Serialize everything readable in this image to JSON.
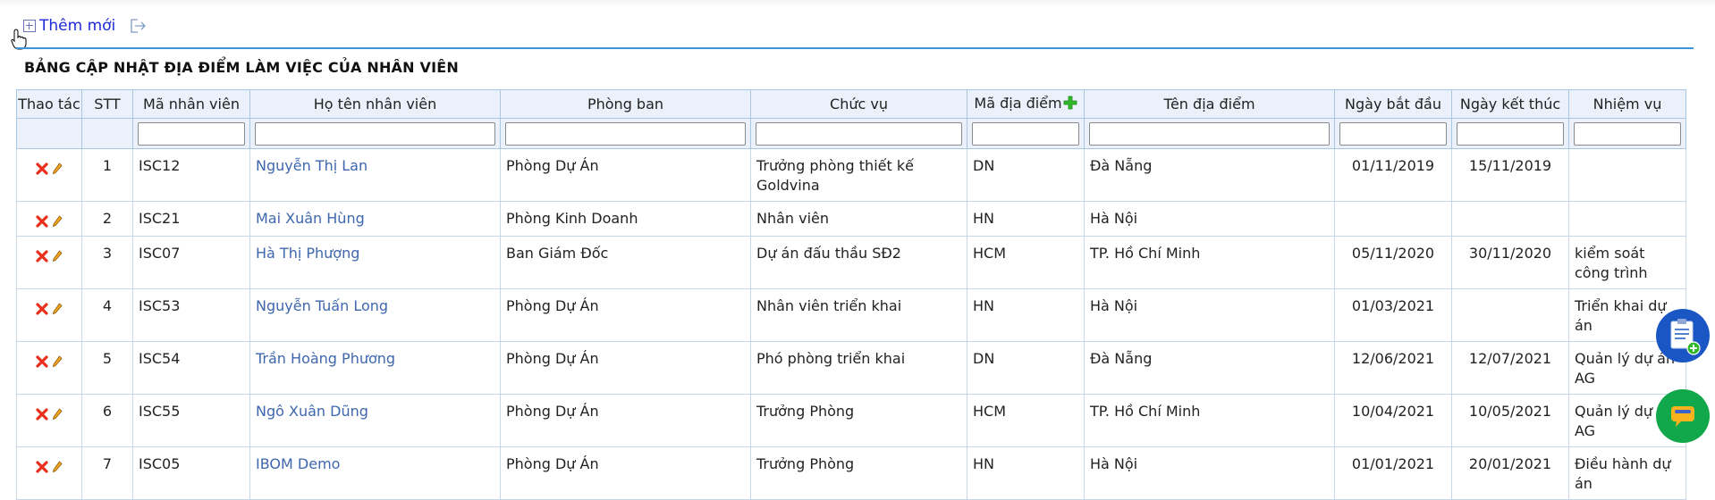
{
  "toolbar": {
    "add_label": "Thêm mới"
  },
  "page_title": "BẢNG CẬP NHẬT ĐỊA ĐIỂM LÀM VIỆC CỦA NHÂN VIÊN",
  "columns": [
    "Thao tác",
    "STT",
    "Mã nhân viên",
    "Họ tên nhân viên",
    "Phòng ban",
    "Chức vụ",
    "Mã địa điểm",
    "Tên địa điểm",
    "Ngày bắt đầu",
    "Ngày kết thúc",
    "Nhiệm vụ"
  ],
  "rows": [
    {
      "stt": "1",
      "ma_nv": "ISC12",
      "ho_ten": "Nguyễn Thị Lan",
      "phong_ban": "Phòng Dự Án",
      "chuc_vu": "Trưởng phòng thiết kế Goldvina",
      "ma_dd": "DN",
      "ten_dd": "Đà Nẵng",
      "bat_dau": "01/11/2019",
      "ket_thuc": "15/11/2019",
      "nhiem_vu": ""
    },
    {
      "stt": "2",
      "ma_nv": "ISC21",
      "ho_ten": "Mai Xuân Hùng",
      "phong_ban": "Phòng Kinh Doanh",
      "chuc_vu": "Nhân viên",
      "ma_dd": "HN",
      "ten_dd": "Hà Nội",
      "bat_dau": "",
      "ket_thuc": "",
      "nhiem_vu": ""
    },
    {
      "stt": "3",
      "ma_nv": "ISC07",
      "ho_ten": "Hà Thị Phượng",
      "phong_ban": "Ban Giám Đốc",
      "chuc_vu": "Dự án đấu thầu SĐ2",
      "ma_dd": "HCM",
      "ten_dd": "TP. Hồ Chí Minh",
      "bat_dau": "05/11/2020",
      "ket_thuc": "30/11/2020",
      "nhiem_vu": "kiểm soát công trình"
    },
    {
      "stt": "4",
      "ma_nv": "ISC53",
      "ho_ten": "Nguyễn Tuấn Long",
      "phong_ban": "Phòng Dự Án",
      "chuc_vu": "Nhân viên triển khai",
      "ma_dd": "HN",
      "ten_dd": "Hà Nội",
      "bat_dau": "01/03/2021",
      "ket_thuc": "",
      "nhiem_vu": "Triển khai dự án"
    },
    {
      "stt": "5",
      "ma_nv": "ISC54",
      "ho_ten": "Trần Hoàng Phương",
      "phong_ban": "Phòng Dự Án",
      "chuc_vu": "Phó phòng triển khai",
      "ma_dd": "DN",
      "ten_dd": "Đà Nẵng",
      "bat_dau": "12/06/2021",
      "ket_thuc": "12/07/2021",
      "nhiem_vu": "Quản lý dự án AG"
    },
    {
      "stt": "6",
      "ma_nv": "ISC55",
      "ho_ten": "Ngô Xuân Dũng",
      "phong_ban": "Phòng Dự Án",
      "chuc_vu": "Trưởng Phòng",
      "ma_dd": "HCM",
      "ten_dd": "TP. Hồ Chí Minh",
      "bat_dau": "10/04/2021",
      "ket_thuc": "10/05/2021",
      "nhiem_vu": "Quản lý dự án AG"
    },
    {
      "stt": "7",
      "ma_nv": "ISC05",
      "ho_ten": "IBOM Demo",
      "phong_ban": "Phòng Dự Án",
      "chuc_vu": "Trưởng Phòng",
      "ma_dd": "HN",
      "ten_dd": "Hà Nội",
      "bat_dau": "01/01/2021",
      "ket_thuc": "20/01/2021",
      "nhiem_vu": "Điều hành dự án"
    }
  ],
  "colors": {
    "accent": "#3a95dc",
    "header_bg": "#eaf1fa",
    "link": "#3e67ad",
    "delete": "#e8301c",
    "add_green": "#2fb82a"
  },
  "icons": {
    "add": "plus-square-icon",
    "export": "export-icon",
    "delete": "delete-x-icon",
    "edit": "pencil-icon",
    "add_location": "green-plus-icon",
    "float_note": "clipboard-add-icon",
    "float_chat": "chat-icon"
  }
}
